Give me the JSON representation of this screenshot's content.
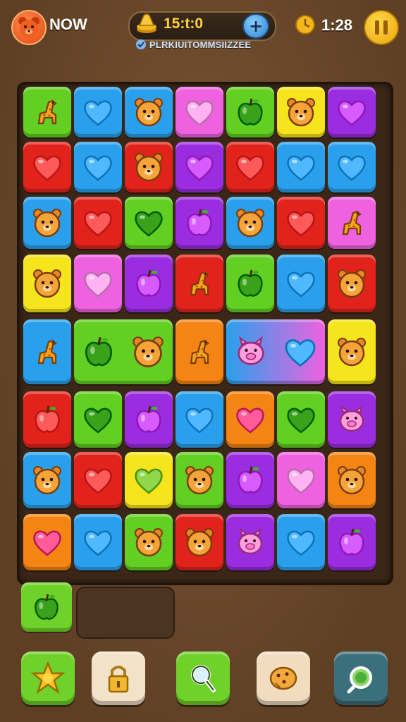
{
  "header": {
    "player_name": "NOW",
    "coins": "15:t:0",
    "subtitle": "PLRKIUITOMMSIIZZEE",
    "timer": "1:28",
    "avatar_icon": "bear-face-icon",
    "coin_icon": "coin-stack-icon",
    "timer_icon": "clock-coin-icon",
    "add_coins_label": "+"
  },
  "colors": {
    "green": "#62cf22",
    "blue": "#2aa0ec",
    "red": "#e2231c",
    "pink": "#ee62e0",
    "purple": "#9a2de0",
    "yellow": "#f6e41c",
    "orange": "#f48414",
    "board": "#3b2717",
    "background": "#6b4a2c"
  },
  "board": {
    "rows": [
      [
        {
          "color": "green",
          "icon": "giraffe"
        },
        {
          "color": "blue",
          "icon": "heart"
        },
        {
          "color": "blue",
          "icon": "bear"
        },
        {
          "color": "pink",
          "icon": "heart"
        },
        {
          "color": "green",
          "icon": "apple"
        },
        {
          "color": "yellow",
          "icon": "bear"
        },
        {
          "color": "purple",
          "icon": "heart"
        }
      ],
      [
        {
          "color": "red",
          "icon": "heart"
        },
        {
          "color": "blue",
          "icon": "heart"
        },
        {
          "color": "red",
          "icon": "bear"
        },
        {
          "color": "purple",
          "icon": "heart"
        },
        {
          "color": "red",
          "icon": "heart"
        },
        {
          "color": "blue",
          "icon": "heart"
        },
        {
          "color": "blue",
          "icon": "heart"
        }
      ],
      [
        {
          "color": "blue",
          "icon": "bear"
        },
        {
          "color": "red",
          "icon": "heart"
        },
        {
          "color": "green",
          "icon": "heart"
        },
        {
          "color": "purple",
          "icon": "apple"
        },
        {
          "color": "blue",
          "icon": "bear"
        },
        {
          "color": "red",
          "icon": "heart"
        },
        {
          "color": "pink",
          "icon": "giraffe"
        }
      ],
      [
        {
          "color": "yellow",
          "icon": "bear"
        },
        {
          "color": "pink",
          "icon": "heart"
        },
        {
          "color": "purple",
          "icon": "apple"
        },
        {
          "color": "red",
          "icon": "giraffe"
        },
        {
          "color": "green",
          "icon": "apple"
        },
        {
          "color": "blue",
          "icon": "heart"
        },
        {
          "color": "red",
          "icon": "bear"
        }
      ],
      [
        {
          "color": "blue",
          "icon": "giraffe"
        },
        {
          "color": "green",
          "icon": "apple",
          "wide": true,
          "second_icon": "bear"
        },
        {
          "color": "orange",
          "icon": "giraffe"
        },
        {
          "color": "blue",
          "icon": "pig",
          "wide": true,
          "second_icon": "heart",
          "gradient": "pink"
        },
        {
          "color": "yellow",
          "icon": "bear"
        }
      ],
      [
        {
          "color": "red",
          "icon": "apple"
        },
        {
          "color": "green",
          "icon": "heart"
        },
        {
          "color": "purple",
          "icon": "apple"
        },
        {
          "color": "blue",
          "icon": "heart"
        },
        {
          "color": "orange",
          "icon": "heart"
        },
        {
          "color": "green",
          "icon": "heart"
        },
        {
          "color": "purple",
          "icon": "pig"
        }
      ],
      [
        {
          "color": "blue",
          "icon": "bear"
        },
        {
          "color": "red",
          "icon": "heart"
        },
        {
          "color": "yellow",
          "icon": "heart"
        },
        {
          "color": "green",
          "icon": "bear"
        },
        {
          "color": "purple",
          "icon": "apple"
        },
        {
          "color": "pink",
          "icon": "heart"
        },
        {
          "color": "orange",
          "icon": "bear"
        }
      ],
      [
        {
          "color": "orange",
          "icon": "heart"
        },
        {
          "color": "blue",
          "icon": "heart"
        },
        {
          "color": "green",
          "icon": "bear"
        },
        {
          "color": "red",
          "icon": "bear"
        },
        {
          "color": "purple",
          "icon": "pig"
        },
        {
          "color": "blue",
          "icon": "heart"
        },
        {
          "color": "purple",
          "icon": "apple"
        }
      ]
    ]
  },
  "tray": {
    "tile": {
      "color": "green",
      "icon": "apple"
    }
  },
  "tools": [
    {
      "name": "star-burst-tool",
      "icon": "star-icon",
      "color": "#6fd12a"
    },
    {
      "name": "lock-tool",
      "icon": "lock-icon",
      "color": "#f2e2c8"
    },
    {
      "name": "magnifier-tool",
      "icon": "magnifier-icon",
      "color": "#6fd12a"
    },
    {
      "name": "cookie-tool",
      "icon": "cookie-icon",
      "color": "#f2dcc0"
    },
    {
      "name": "refresh-tool",
      "icon": "refresh-icon",
      "color": "#3c6f7c"
    }
  ]
}
